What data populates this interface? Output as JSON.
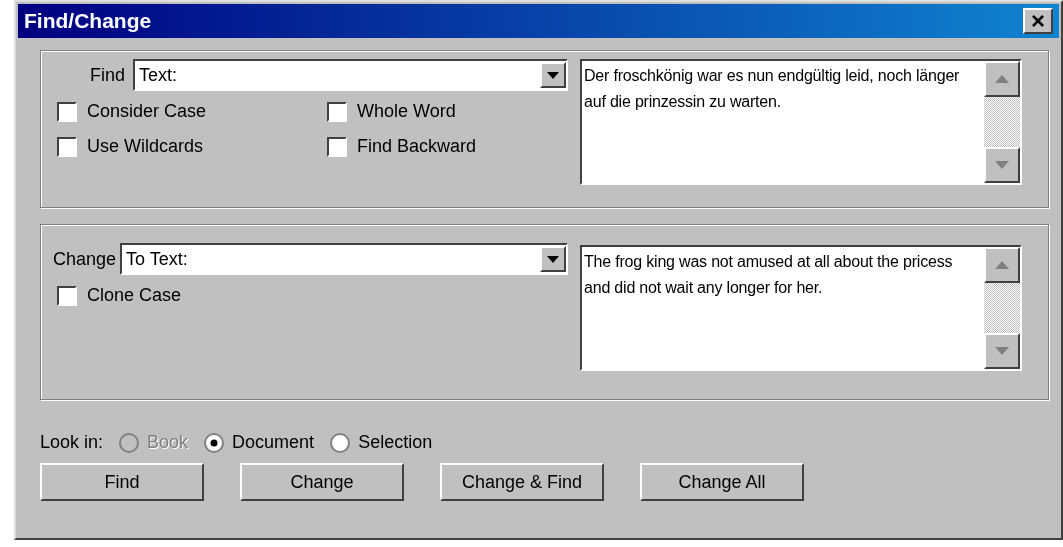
{
  "window": {
    "title": "Find/Change",
    "close_glyph": "×"
  },
  "find_section": {
    "label": "Find",
    "combo_value": "Text:",
    "text": "Der froschkönig war es nun endgültig leid, noch länger auf die prinzessin zu warten.",
    "options": [
      {
        "label": "Consider Case",
        "checked": false
      },
      {
        "label": "Whole Word",
        "checked": false
      },
      {
        "label": "Use Wildcards",
        "checked": false
      },
      {
        "label": "Find Backward",
        "checked": false
      }
    ]
  },
  "change_section": {
    "label": "Change",
    "combo_value": "To Text:",
    "text": "The frog king was not amused at all about the pricess and did not wait any longer for her.",
    "options": [
      {
        "label": "Clone Case",
        "checked": false
      }
    ]
  },
  "look_in": {
    "label": "Look in:",
    "options": [
      {
        "label": "Book",
        "selected": false,
        "disabled": true
      },
      {
        "label": "Document",
        "selected": true,
        "disabled": false
      },
      {
        "label": "Selection",
        "selected": false,
        "disabled": false
      }
    ]
  },
  "buttons": [
    "Find",
    "Change",
    "Change & Find",
    "Change All"
  ]
}
